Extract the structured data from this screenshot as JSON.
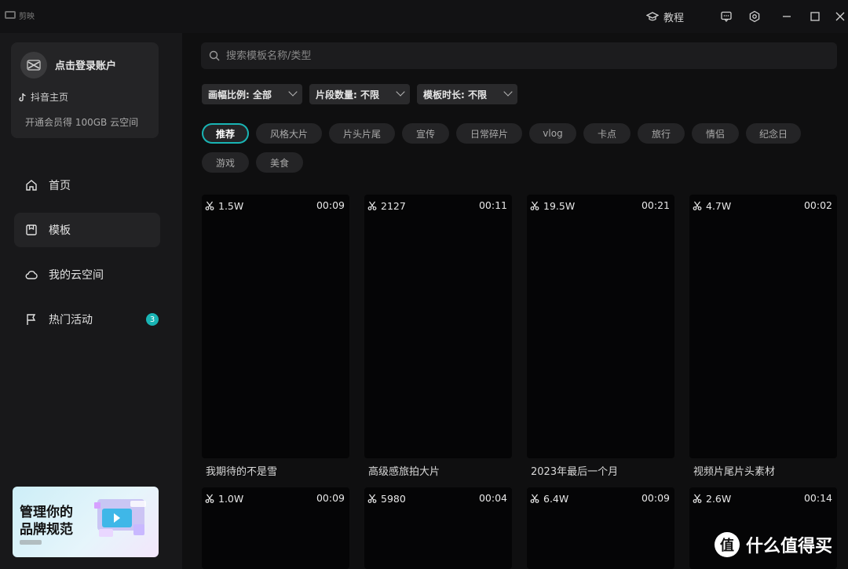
{
  "titlebar": {
    "app_name": "剪映",
    "tutorial_label": "教程"
  },
  "sidebar": {
    "account": {
      "login_label": "点击登录账户",
      "douyin_label": "抖音主页",
      "vip_label": "开通会员得 100GB 云空间"
    },
    "nav": [
      {
        "label": "首页",
        "icon": "home-icon"
      },
      {
        "label": "模板",
        "icon": "template-icon"
      },
      {
        "label": "我的云空间",
        "icon": "cloud-icon"
      },
      {
        "label": "热门活动",
        "icon": "flag-icon",
        "badge": "3"
      }
    ],
    "promo": {
      "line1": "管理你的",
      "line2": "品牌规范"
    }
  },
  "search": {
    "placeholder": "搜索模板名称/类型"
  },
  "filters": [
    {
      "label": "画幅比例: 全部"
    },
    {
      "label": "片段数量: 不限"
    },
    {
      "label": "模板时长: 不限"
    }
  ],
  "tags": [
    "推荐",
    "风格大片",
    "片头片尾",
    "宣传",
    "日常碎片",
    "vlog",
    "卡点",
    "旅行",
    "情侣",
    "纪念日",
    "游戏",
    "美食"
  ],
  "templates_row1": [
    {
      "uses": "1.5W",
      "duration": "00:09",
      "title": "我期待的不是雪"
    },
    {
      "uses": "2127",
      "duration": "00:11",
      "title": "高级感旅拍大片"
    },
    {
      "uses": "19.5W",
      "duration": "00:21",
      "title": "2023年最后一个月"
    },
    {
      "uses": "4.7W",
      "duration": "00:02",
      "title": "视频片尾片头素材"
    }
  ],
  "templates_row2": [
    {
      "uses": "1.0W",
      "duration": "00:09"
    },
    {
      "uses": "5980",
      "duration": "00:04"
    },
    {
      "uses": "6.4W",
      "duration": "00:09"
    },
    {
      "uses": "2.6W",
      "duration": "00:14"
    }
  ],
  "watermark": {
    "glyph": "值",
    "text": "什么值得买"
  },
  "colors": {
    "accent": "#19b4b4",
    "background": "#0f0f10",
    "sidebar": "#18181a"
  }
}
